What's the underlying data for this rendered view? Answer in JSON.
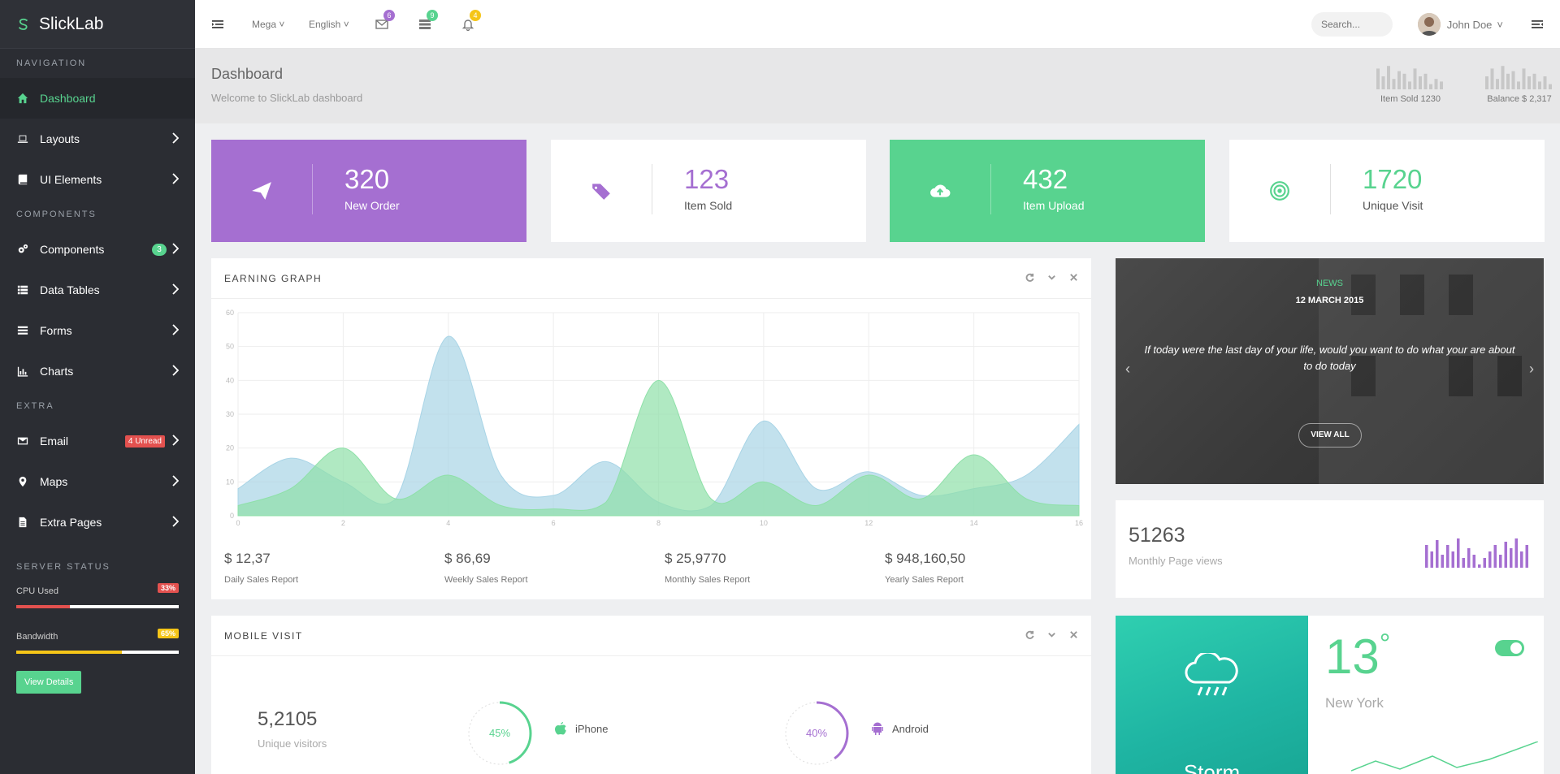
{
  "brand": {
    "name": "SlickLab"
  },
  "nav": {
    "section_navigation": "NAVIGATION",
    "section_components": "COMPONENTS",
    "section_extra": "EXTRA",
    "dashboard": "Dashboard",
    "layouts": "Layouts",
    "ui_elements": "UI Elements",
    "components": "Components",
    "components_badge": "3",
    "data_tables": "Data Tables",
    "forms": "Forms",
    "charts": "Charts",
    "email": "Email",
    "email_badge": "4 Unread",
    "maps": "Maps",
    "extra_pages": "Extra Pages"
  },
  "server": {
    "title": "SERVER STATUS",
    "cpu_label": "CPU Used",
    "cpu_pct": "33%",
    "cpu_value": 0.33,
    "cpu_color": "#e3514f",
    "bw_label": "Bandwidth",
    "bw_pct": "65%",
    "bw_value": 0.65,
    "bw_color": "#f5c518",
    "button": "View Details"
  },
  "topbar": {
    "mega": "Mega",
    "language": "English",
    "mail_count": "6",
    "tasks_count": "9",
    "notif_count": "4",
    "search_placeholder": "Search...",
    "user_name": "John Doe"
  },
  "header": {
    "title": "Dashboard",
    "subtitle": "Welcome to SlickLab dashboard",
    "spark1_label": "Item Sold 1230",
    "spark2_label": "Balance $ 2,317"
  },
  "stats": [
    {
      "value": "320",
      "label": "New Order",
      "bg": "#a56fd1",
      "fg": "#ffffff",
      "icon": "paper-plane-icon"
    },
    {
      "value": "123",
      "label": "Item Sold",
      "bg": "#ffffff",
      "fg": "#a56fd1",
      "icon": "tags-icon"
    },
    {
      "value": "432",
      "label": "Item Upload",
      "bg": "#58d38f",
      "fg": "#ffffff",
      "icon": "cloud-upload-icon"
    },
    {
      "value": "1720",
      "label": "Unique Visit",
      "bg": "#ffffff",
      "fg": "#58d38f",
      "icon": "target-icon"
    }
  ],
  "earning": {
    "title": "EARNING GRAPH",
    "reports": [
      {
        "value": "$ 12,37",
        "label": "Daily Sales Report"
      },
      {
        "value": "$ 86,69",
        "label": "Weekly Sales Report"
      },
      {
        "value": "$ 25,9770",
        "label": "Monthly Sales Report"
      },
      {
        "value": "$ 948,160,50",
        "label": "Yearly Sales Report"
      }
    ]
  },
  "chart_data": {
    "type": "area",
    "x": [
      0,
      1,
      2,
      3,
      4,
      5,
      6,
      7,
      8,
      9,
      10,
      11,
      12,
      13,
      14,
      15,
      16
    ],
    "series": [
      {
        "values": [
          8,
          17,
          10,
          5,
          53,
          12,
          6,
          16,
          4,
          3,
          28,
          8,
          13,
          6,
          8,
          12,
          27
        ],
        "color": "#a8d4e6"
      },
      {
        "values": [
          3,
          8,
          20,
          5,
          12,
          3,
          2,
          4,
          40,
          5,
          10,
          3,
          12,
          5,
          18,
          5,
          3
        ],
        "color": "#8ee0a8"
      }
    ],
    "xticks": [
      "0",
      "2",
      "4",
      "6",
      "8",
      "10",
      "12",
      "14",
      "16"
    ],
    "yticks": [
      "0",
      "10",
      "20",
      "30",
      "40",
      "50",
      "60"
    ],
    "xlim": [
      0,
      16
    ],
    "ylim": [
      0,
      60
    ],
    "grid": true
  },
  "news": {
    "tag": "NEWS",
    "date": "12 MARCH 2015",
    "quote": "If today were the last day of your life, would you want to do what your are about to do today",
    "button": "VIEW ALL"
  },
  "pageviews": {
    "value": "51263",
    "label": "Monthly Page views"
  },
  "mobile": {
    "title": "MOBILE VISIT",
    "unique_value": "5,2105",
    "unique_label": "Unique visitors",
    "iphone_pct": "45%",
    "iphone_value": 0.45,
    "iphone_label": "iPhone",
    "android_pct": "40%",
    "android_value": 0.4,
    "android_label": "Android"
  },
  "weather": {
    "temp": "13",
    "degree": "°",
    "city": "New York",
    "condition": "Storm"
  }
}
